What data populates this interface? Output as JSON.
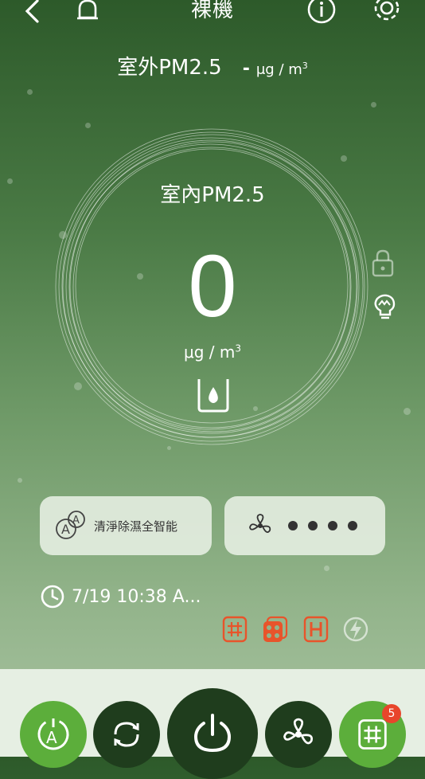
{
  "header": {
    "title": "裸機"
  },
  "outdoor": {
    "label": "室外PM2.5",
    "value": "-",
    "unit": "μg / m",
    "unit_sup": "3"
  },
  "indoor": {
    "label": "室內PM2.5",
    "value": "0",
    "unit": "μg / m",
    "unit_sup": "3"
  },
  "mode_card": {
    "label": "清淨除濕全智能"
  },
  "fan_card": {
    "speed_level": 4
  },
  "timer": {
    "text": "7/19 10:38 A..."
  },
  "bottom_nav": {
    "grid_badge_count": "5"
  },
  "colors": {
    "accent_orange": "#e8542b",
    "active_green": "#5cae3b",
    "dark_btn": "#1f3d1d"
  }
}
